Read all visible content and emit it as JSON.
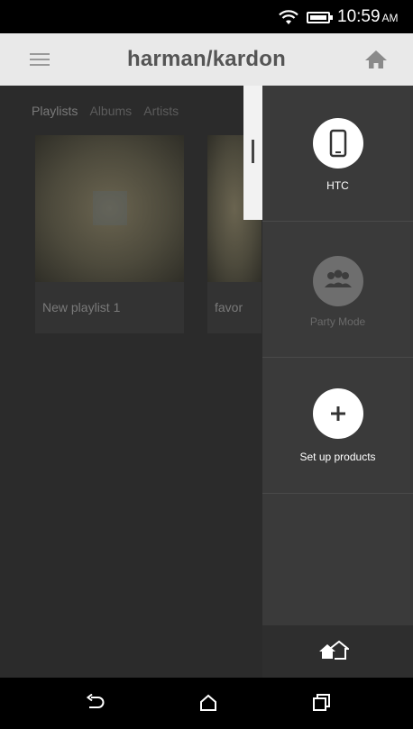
{
  "status_bar": {
    "time": "10:59",
    "ampm": "AM",
    "icons": [
      "wifi-icon",
      "battery-icon"
    ]
  },
  "app_bar": {
    "brand": "harman/kardon",
    "menu_icon": "hamburger-menu-icon",
    "home_icon": "home-icon"
  },
  "library": {
    "tabs": [
      {
        "label": "Playlists"
      },
      {
        "label": "Albums"
      },
      {
        "label": "Artists"
      }
    ],
    "playlists": [
      {
        "name": "New playlist 1"
      },
      {
        "name": "favor"
      }
    ]
  },
  "device_drawer": {
    "items": [
      {
        "label": "HTC",
        "icon": "phone-icon",
        "enabled": true
      },
      {
        "label": "Party Mode",
        "icon": "group-icon",
        "enabled": false
      },
      {
        "label": "Set up products",
        "icon": "plus-icon",
        "enabled": true
      }
    ],
    "footer_icon": "multi-home-icon"
  },
  "nav_bar": {
    "icons": [
      "back-icon",
      "home-icon",
      "recents-icon"
    ]
  },
  "colors": {
    "app_bar_bg": "#e9e9e9",
    "drawer_bg": "#3a3a3a",
    "content_bg": "#2b2b2b"
  }
}
